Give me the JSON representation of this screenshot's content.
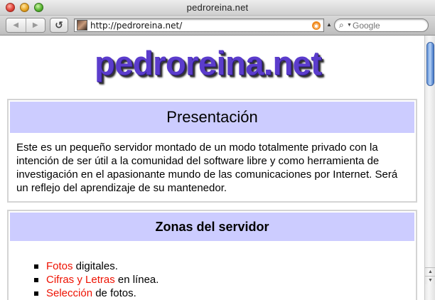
{
  "window": {
    "title": "pedroreina.net"
  },
  "toolbar": {
    "back_icon": "back-arrow-icon",
    "forward_icon": "forward-arrow-icon",
    "reload_icon": "reload-icon",
    "url": "http://pedroreina.net/",
    "search_placeholder": "Google"
  },
  "page": {
    "logo_text": "pedroreina.net",
    "sections": [
      {
        "heading": "Presentación",
        "body": "Este es un pequeño servidor montado de un modo totalmente privado con la intención de ser útil a la comunidad del software libre y como herramienta de investigación en el apasionante mundo de las comunicaciones por Internet. Será un reflejo del aprendizaje de su mantenedor."
      },
      {
        "heading": "Zonas del servidor",
        "items": [
          {
            "link": "Fotos",
            "rest": " digitales."
          },
          {
            "link": "Cifras y Letras",
            "rest": " en línea."
          },
          {
            "link": "Selección",
            "rest": " de fotos."
          }
        ]
      }
    ]
  },
  "colors": {
    "section_header_bg": "#ccccff",
    "link": "#ee1100",
    "logo": "#5b3ccc"
  }
}
